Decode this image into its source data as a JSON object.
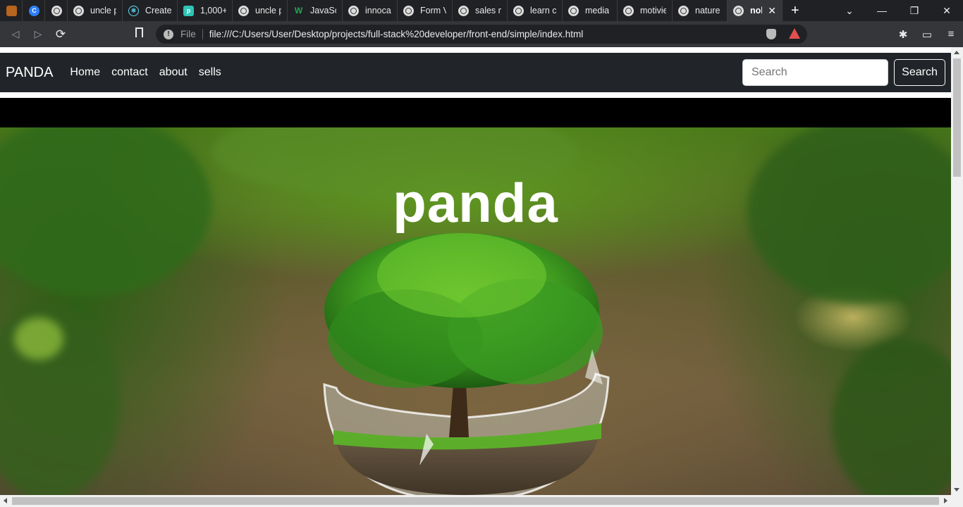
{
  "browser": {
    "tabs": [
      {
        "label": "",
        "icon": "pinned-app-icon",
        "color": "#b5651d"
      },
      {
        "label": "",
        "icon": "c-icon",
        "color": "#2d7ff9"
      },
      {
        "label": "",
        "icon": "globe-icon"
      },
      {
        "label": "uncle p",
        "icon": "globe-icon"
      },
      {
        "label": "Create a",
        "icon": "react-icon",
        "color": "#61dafb"
      },
      {
        "label": "1,000+",
        "icon": "p-icon",
        "color": "#2ec4b6"
      },
      {
        "label": "uncle p",
        "icon": "globe-icon"
      },
      {
        "label": "JavaScr",
        "icon": "w-icon",
        "color": "#1fa855"
      },
      {
        "label": "innocal",
        "icon": "globe-icon"
      },
      {
        "label": "Form Va",
        "icon": "globe-icon"
      },
      {
        "label": "sales m",
        "icon": "globe-icon"
      },
      {
        "label": "learn ch",
        "icon": "globe-icon"
      },
      {
        "label": "media",
        "icon": "globe-icon"
      },
      {
        "label": "motivie",
        "icon": "globe-icon"
      },
      {
        "label": "nature",
        "icon": "globe-icon"
      },
      {
        "label": "nok",
        "icon": "globe-icon",
        "active": true
      }
    ],
    "address": {
      "scheme_label": "File",
      "url": "file:///C:/Users/User/Desktop/projects/full-stack%20developer/front-end/simple/index.html"
    }
  },
  "site": {
    "brand": "PANDA",
    "nav": [
      "Home",
      "contact",
      "about",
      "sells"
    ],
    "search_placeholder": "Search",
    "search_button": "Search",
    "hero_title": "panda"
  },
  "colors": {
    "navbar_bg": "#212529",
    "tab_strip_bg": "#202124",
    "toolbar_bg": "#35363a"
  }
}
